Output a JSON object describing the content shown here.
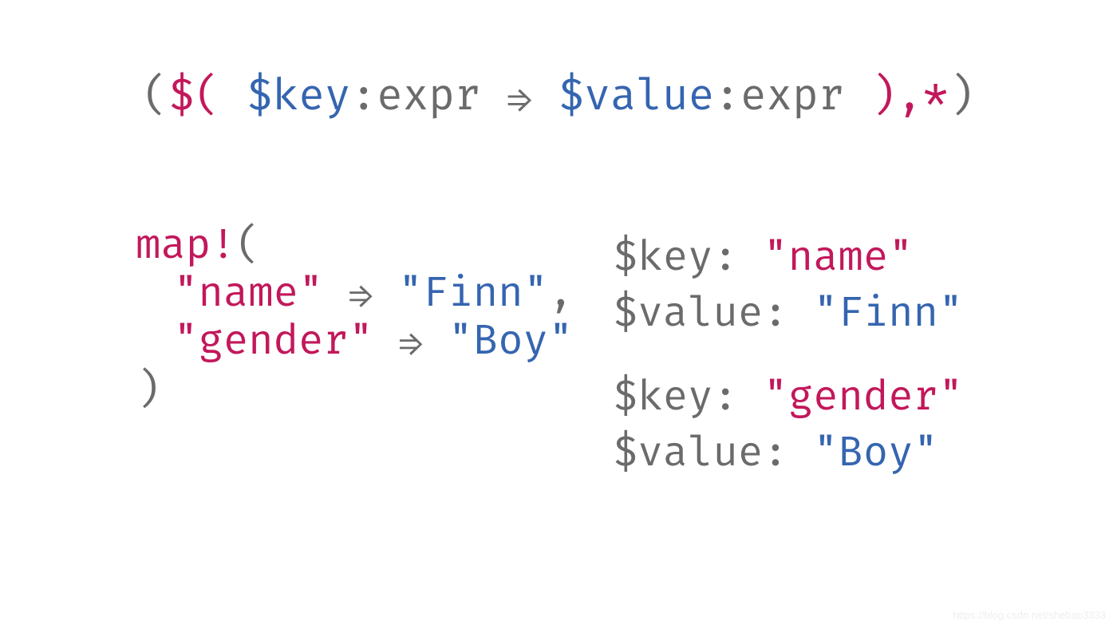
{
  "pattern": {
    "open_paren1": "(",
    "dollar_open": "$(",
    "space": " ",
    "key_var": "$key",
    "colon1": ":",
    "expr1": "expr",
    "arrow": "⇒",
    "value_var": "$value",
    "colon2": ":",
    "expr2": "expr",
    "close_comma_star": "),*",
    "close_paren2": ")",
    "sep_space": " "
  },
  "invocation": {
    "map_name": "map!",
    "open": "(",
    "line1": {
      "key": "\"name\"",
      "arrow": "⇒",
      "value": "\"Finn\"",
      "comma": ","
    },
    "line2": {
      "key": "\"gender\"",
      "arrow": "⇒",
      "value": "\"Boy\""
    },
    "close": ")"
  },
  "bindings": {
    "group1": {
      "key_label": "$key:",
      "key_value": "\"name\"",
      "value_label": "$value:",
      "value_value": "\"Finn\""
    },
    "group2": {
      "key_label": "$key:",
      "key_value": "\"gender\"",
      "value_label": "$value:",
      "value_value": "\"Boy\""
    }
  },
  "watermark": "https://blog.csdn.net/shebao3333"
}
